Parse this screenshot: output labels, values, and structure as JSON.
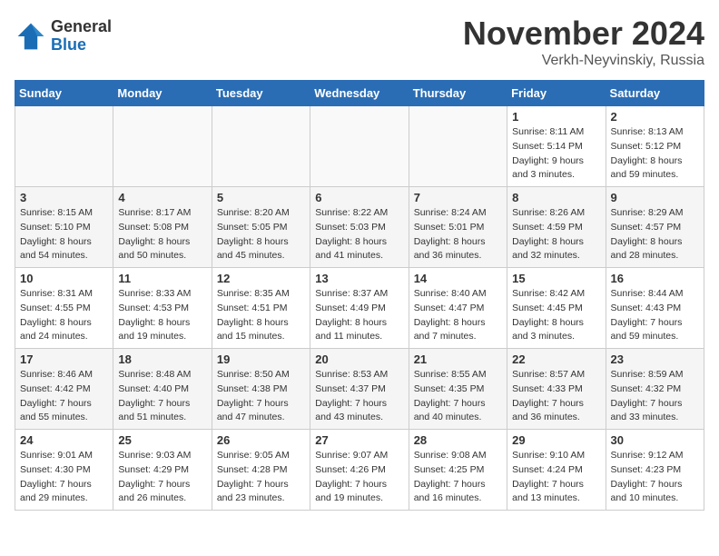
{
  "logo": {
    "general": "General",
    "blue": "Blue"
  },
  "title": "November 2024",
  "location": "Verkh-Neyvinskiy, Russia",
  "days_of_week": [
    "Sunday",
    "Monday",
    "Tuesday",
    "Wednesday",
    "Thursday",
    "Friday",
    "Saturday"
  ],
  "weeks": [
    [
      {
        "day": "",
        "detail": ""
      },
      {
        "day": "",
        "detail": ""
      },
      {
        "day": "",
        "detail": ""
      },
      {
        "day": "",
        "detail": ""
      },
      {
        "day": "",
        "detail": ""
      },
      {
        "day": "1",
        "detail": "Sunrise: 8:11 AM\nSunset: 5:14 PM\nDaylight: 9 hours\nand 3 minutes."
      },
      {
        "day": "2",
        "detail": "Sunrise: 8:13 AM\nSunset: 5:12 PM\nDaylight: 8 hours\nand 59 minutes."
      }
    ],
    [
      {
        "day": "3",
        "detail": "Sunrise: 8:15 AM\nSunset: 5:10 PM\nDaylight: 8 hours\nand 54 minutes."
      },
      {
        "day": "4",
        "detail": "Sunrise: 8:17 AM\nSunset: 5:08 PM\nDaylight: 8 hours\nand 50 minutes."
      },
      {
        "day": "5",
        "detail": "Sunrise: 8:20 AM\nSunset: 5:05 PM\nDaylight: 8 hours\nand 45 minutes."
      },
      {
        "day": "6",
        "detail": "Sunrise: 8:22 AM\nSunset: 5:03 PM\nDaylight: 8 hours\nand 41 minutes."
      },
      {
        "day": "7",
        "detail": "Sunrise: 8:24 AM\nSunset: 5:01 PM\nDaylight: 8 hours\nand 36 minutes."
      },
      {
        "day": "8",
        "detail": "Sunrise: 8:26 AM\nSunset: 4:59 PM\nDaylight: 8 hours\nand 32 minutes."
      },
      {
        "day": "9",
        "detail": "Sunrise: 8:29 AM\nSunset: 4:57 PM\nDaylight: 8 hours\nand 28 minutes."
      }
    ],
    [
      {
        "day": "10",
        "detail": "Sunrise: 8:31 AM\nSunset: 4:55 PM\nDaylight: 8 hours\nand 24 minutes."
      },
      {
        "day": "11",
        "detail": "Sunrise: 8:33 AM\nSunset: 4:53 PM\nDaylight: 8 hours\nand 19 minutes."
      },
      {
        "day": "12",
        "detail": "Sunrise: 8:35 AM\nSunset: 4:51 PM\nDaylight: 8 hours\nand 15 minutes."
      },
      {
        "day": "13",
        "detail": "Sunrise: 8:37 AM\nSunset: 4:49 PM\nDaylight: 8 hours\nand 11 minutes."
      },
      {
        "day": "14",
        "detail": "Sunrise: 8:40 AM\nSunset: 4:47 PM\nDaylight: 8 hours\nand 7 minutes."
      },
      {
        "day": "15",
        "detail": "Sunrise: 8:42 AM\nSunset: 4:45 PM\nDaylight: 8 hours\nand 3 minutes."
      },
      {
        "day": "16",
        "detail": "Sunrise: 8:44 AM\nSunset: 4:43 PM\nDaylight: 7 hours\nand 59 minutes."
      }
    ],
    [
      {
        "day": "17",
        "detail": "Sunrise: 8:46 AM\nSunset: 4:42 PM\nDaylight: 7 hours\nand 55 minutes."
      },
      {
        "day": "18",
        "detail": "Sunrise: 8:48 AM\nSunset: 4:40 PM\nDaylight: 7 hours\nand 51 minutes."
      },
      {
        "day": "19",
        "detail": "Sunrise: 8:50 AM\nSunset: 4:38 PM\nDaylight: 7 hours\nand 47 minutes."
      },
      {
        "day": "20",
        "detail": "Sunrise: 8:53 AM\nSunset: 4:37 PM\nDaylight: 7 hours\nand 43 minutes."
      },
      {
        "day": "21",
        "detail": "Sunrise: 8:55 AM\nSunset: 4:35 PM\nDaylight: 7 hours\nand 40 minutes."
      },
      {
        "day": "22",
        "detail": "Sunrise: 8:57 AM\nSunset: 4:33 PM\nDaylight: 7 hours\nand 36 minutes."
      },
      {
        "day": "23",
        "detail": "Sunrise: 8:59 AM\nSunset: 4:32 PM\nDaylight: 7 hours\nand 33 minutes."
      }
    ],
    [
      {
        "day": "24",
        "detail": "Sunrise: 9:01 AM\nSunset: 4:30 PM\nDaylight: 7 hours\nand 29 minutes."
      },
      {
        "day": "25",
        "detail": "Sunrise: 9:03 AM\nSunset: 4:29 PM\nDaylight: 7 hours\nand 26 minutes."
      },
      {
        "day": "26",
        "detail": "Sunrise: 9:05 AM\nSunset: 4:28 PM\nDaylight: 7 hours\nand 23 minutes."
      },
      {
        "day": "27",
        "detail": "Sunrise: 9:07 AM\nSunset: 4:26 PM\nDaylight: 7 hours\nand 19 minutes."
      },
      {
        "day": "28",
        "detail": "Sunrise: 9:08 AM\nSunset: 4:25 PM\nDaylight: 7 hours\nand 16 minutes."
      },
      {
        "day": "29",
        "detail": "Sunrise: 9:10 AM\nSunset: 4:24 PM\nDaylight: 7 hours\nand 13 minutes."
      },
      {
        "day": "30",
        "detail": "Sunrise: 9:12 AM\nSunset: 4:23 PM\nDaylight: 7 hours\nand 10 minutes."
      }
    ]
  ]
}
